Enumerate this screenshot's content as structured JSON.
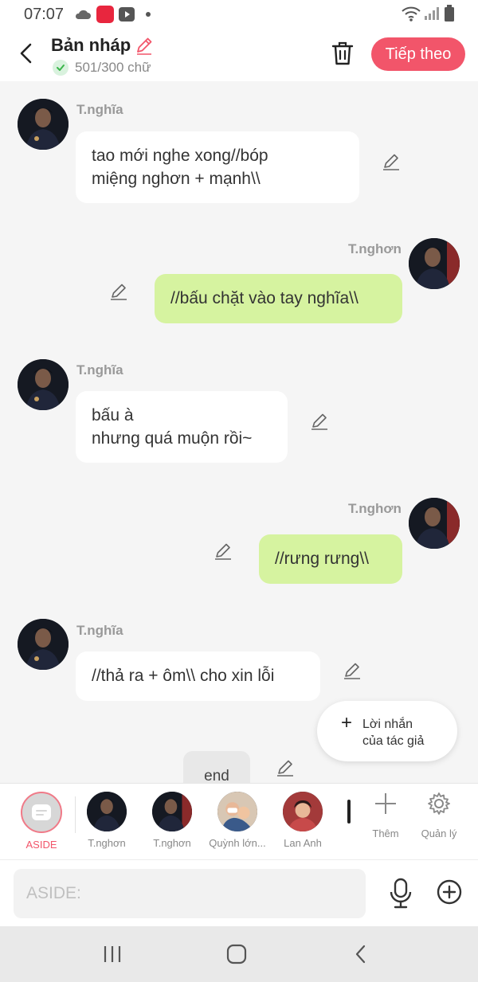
{
  "status_bar": {
    "time": "07:07",
    "icons": [
      "cloud-icon",
      "mangatoon-app-icon",
      "youtube-app-icon",
      "dot-icon",
      "wifi-icon",
      "signal-icon",
      "battery-icon"
    ]
  },
  "header": {
    "title": "Bản nháp",
    "word_count": "501/300 chữ",
    "next_label": "Tiếp theo",
    "accent_color": "#f2556a"
  },
  "messages": [
    {
      "sender": "T.nghĩa",
      "side": "left",
      "lines": [
        "tao mới nghe xong//bóp",
        "miệng nghơn + mạnh\\\\"
      ]
    },
    {
      "sender": "T.nghơn",
      "side": "right",
      "lines": [
        "//bấu chặt vào tay nghĩa\\\\"
      ]
    },
    {
      "sender": "T.nghĩa",
      "side": "left",
      "lines": [
        "bấu à",
        "nhưng quá muộn rồi~"
      ]
    },
    {
      "sender": "T.nghơn",
      "side": "right",
      "lines": [
        "//rưng rưng\\\\"
      ]
    },
    {
      "sender": "T.nghĩa",
      "side": "left",
      "lines": [
        "//thả ra + ôm\\\\ cho xin lỗi"
      ]
    }
  ],
  "author_note": {
    "line1": "Lời nhắn",
    "line2": "của tác giả"
  },
  "end_label": "end",
  "characters": [
    {
      "label": "ASIDE",
      "selected": true
    },
    {
      "label": "T.nghơn"
    },
    {
      "label": "T.nghơn"
    },
    {
      "label": "Quỳnh lớn..."
    },
    {
      "label": "Lan Anh"
    }
  ],
  "tools": {
    "add_label": "Thêm",
    "manage_label": "Quản lý"
  },
  "input": {
    "placeholder": "ASIDE:",
    "value": ""
  },
  "colors": {
    "left_bubble": "#ffffff",
    "right_bubble": "#d6f3a0",
    "background": "#f5f5f5"
  }
}
